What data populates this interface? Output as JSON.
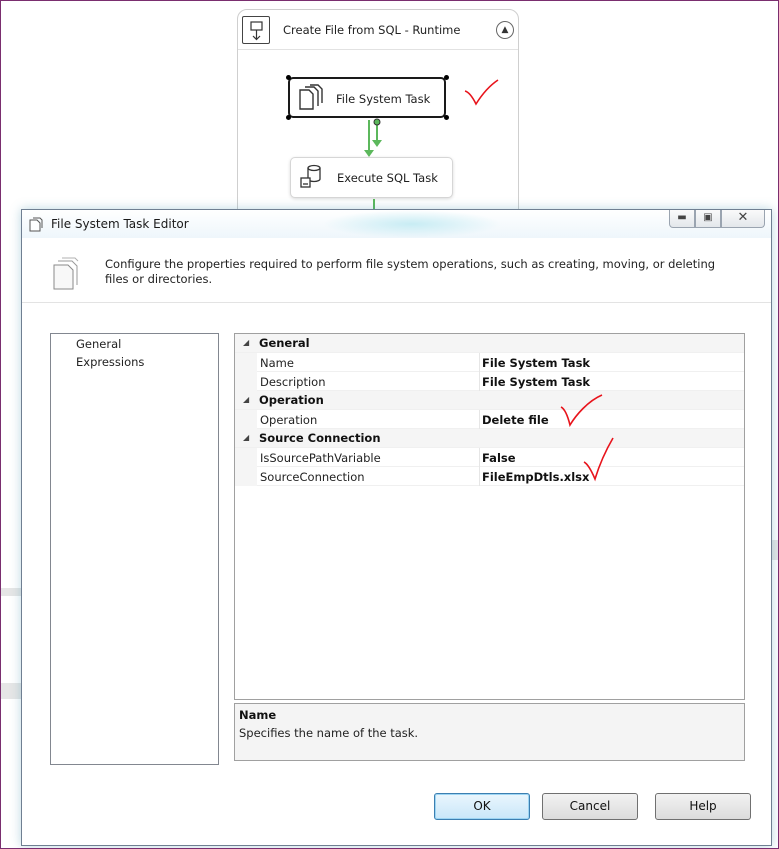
{
  "designer": {
    "container_title": "Create File from SQL - Runtime",
    "collapse_icon": "chevron-up-icon",
    "tasks": [
      {
        "label": "File System Task",
        "icon": "file-system-icon"
      },
      {
        "label": "Execute SQL Task",
        "icon": "database-icon"
      }
    ]
  },
  "dialog": {
    "title": "File System Task Editor",
    "window_buttons": {
      "minimize": "minimize-icon",
      "maximize": "maximize-icon",
      "close": "close-icon"
    },
    "header_text": "Configure the properties required to perform file system operations, such as creating, moving, or deleting files or directories.",
    "nav_items": [
      "General",
      "Expressions"
    ],
    "property_grid": [
      {
        "category": "General",
        "properties": [
          {
            "name": "Name",
            "value": "File System Task"
          },
          {
            "name": "Description",
            "value": "File System Task"
          }
        ]
      },
      {
        "category": "Operation",
        "properties": [
          {
            "name": "Operation",
            "value": "Delete file"
          }
        ]
      },
      {
        "category": "Source Connection",
        "properties": [
          {
            "name": "IsSourcePathVariable",
            "value": "False"
          },
          {
            "name": "SourceConnection",
            "value": "FileEmpDtls.xlsx"
          }
        ]
      }
    ],
    "description": {
      "title": "Name",
      "text": "Specifies the name of the task."
    },
    "buttons": {
      "ok": "OK",
      "cancel": "Cancel",
      "help": "Help"
    }
  },
  "colors": {
    "annotation_red": "#e8141c",
    "connector_green": "#5cb85c",
    "dialog_border": "#6f7f92"
  }
}
